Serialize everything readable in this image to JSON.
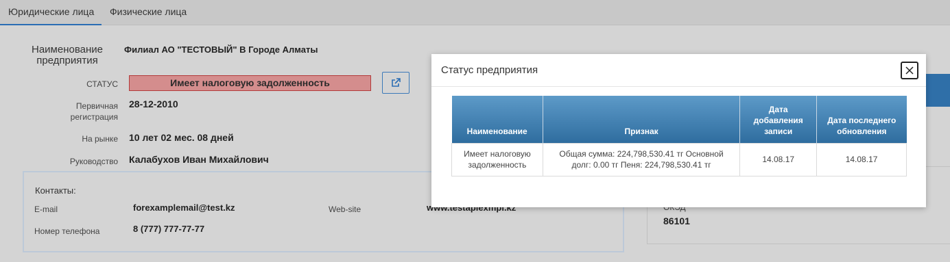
{
  "tabs": [
    {
      "label": "Юридические лица",
      "active": true
    },
    {
      "label": "Физические лица",
      "active": false
    }
  ],
  "company": {
    "name_label": "Наименование предприятия",
    "name_value": "Филиал АО \"ТЕСТОВЫЙ\" В Городе Алматы",
    "status_label": "СТАТУС",
    "status_value": "Имеет налоговую задолженность",
    "registration_label": "Первичная регистрация",
    "registration_value": "28-12-2010",
    "market_label": "На рынке",
    "market_value": "10 лет 02 мес. 08 дней",
    "director_label": "Руководство",
    "director_value": "Калабухов Иван Михайлович"
  },
  "contacts": {
    "title": "Контакты:",
    "email_label": "E-mail",
    "email_value": "forexamplemail@test.kz",
    "phone_label": "Номер телефона",
    "phone_value": "8 (777) 777-77-77",
    "website_label": "Web-site",
    "website_value": "www.testaplexmpl.kz"
  },
  "side": {
    "okved_label": "ОКЭД",
    "okved_value": "86101"
  },
  "modal": {
    "title": "Статус предприятия",
    "columns": [
      "Наименование",
      "Признак",
      "Дата добавления записи",
      "Дата последнего обновления"
    ],
    "rows": [
      [
        "Имеет налоговую задолженность",
        "Общая сумма: 224,798,530.41 тг Основной долг: 0.00 тг Пеня: 224,798,530.41 тг",
        "14.08.17",
        "14.08.17"
      ]
    ]
  },
  "colors": {
    "accent": "#2a6db4",
    "status_bg": "#d48d8d",
    "status_border": "#b23a3a",
    "table_header": "#2f6d9f"
  }
}
